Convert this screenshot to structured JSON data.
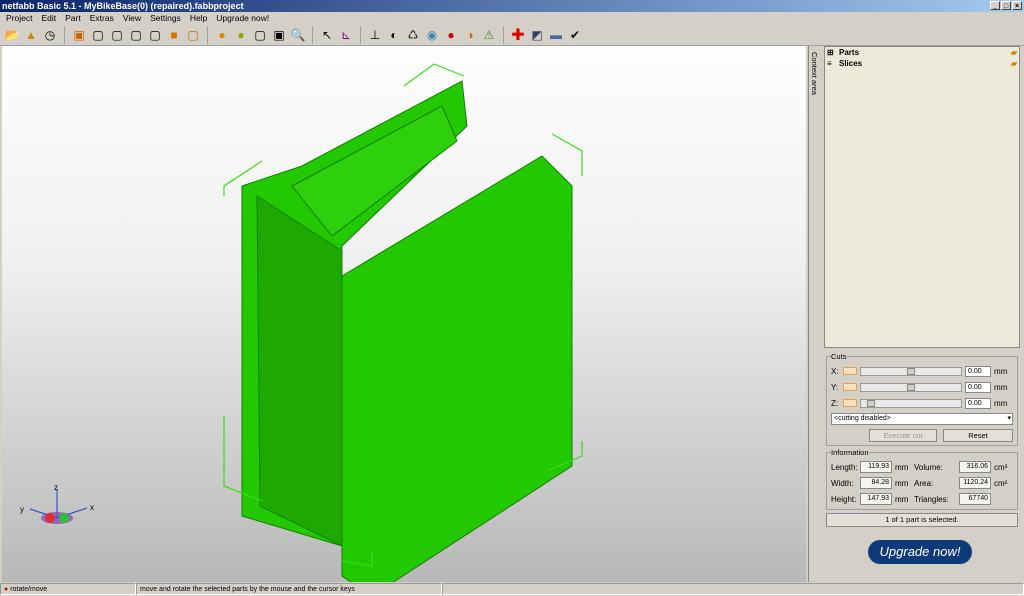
{
  "title": "netfabb Basic 5.1 - MyBikeBase(0) (repaired).fabbproject",
  "menu": [
    "Project",
    "Edit",
    "Part",
    "Extras",
    "View",
    "Settings",
    "Help",
    "Upgrade now!"
  ],
  "context_tab": "Context area",
  "tree": {
    "parts": "Parts",
    "slices": "Slices"
  },
  "cuts": {
    "legend": "Cuts",
    "x_label": "X:",
    "y_label": "Y:",
    "z_label": "Z:",
    "x": "0.00",
    "y": "0.00",
    "z": "0.00",
    "unit": "mm",
    "mode": "<cutting disabled>",
    "execute": "Execute cut",
    "reset": "Reset"
  },
  "info": {
    "legend": "Information",
    "length_label": "Length:",
    "length": "119.93",
    "width_label": "Width:",
    "width": "84.28",
    "height_label": "Height:",
    "height": "147.93",
    "mm": "mm",
    "volume_label": "Volume:",
    "volume": "316.06",
    "volume_unit": "cm³",
    "area_label": "Area:",
    "area": "1120.24",
    "area_unit": "cm²",
    "triangles_label": "Triangles:",
    "triangles": "67740"
  },
  "selection": "1 of 1 part is selected.",
  "upgrade": "Upgrade now!",
  "axes": {
    "x": "x",
    "y": "y",
    "z": "z"
  },
  "status": {
    "mode": "rotate/move",
    "hint": "move and rotate the selected parts by the mouse and the cursor keys"
  }
}
